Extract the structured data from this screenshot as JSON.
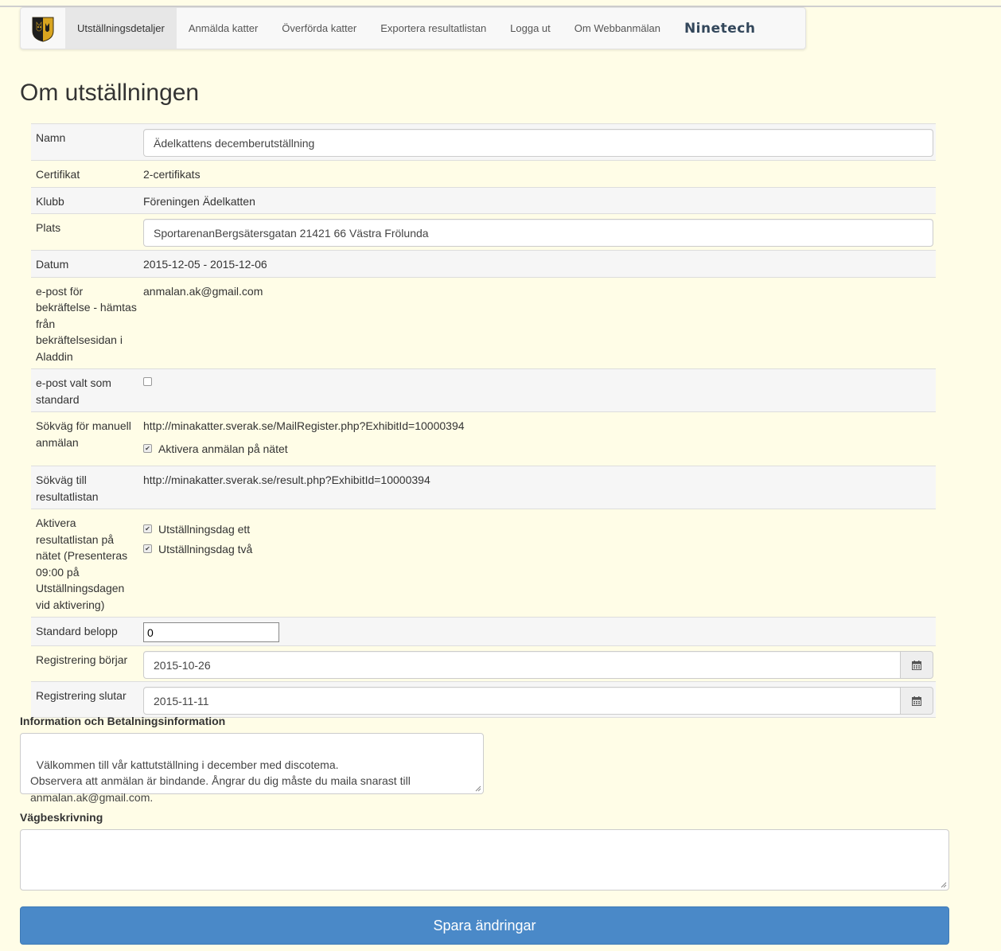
{
  "nav": {
    "items": [
      {
        "label": "Utställningsdetaljer"
      },
      {
        "label": "Anmälda katter"
      },
      {
        "label": "Överförda katter"
      },
      {
        "label": "Exportera resultatlistan"
      },
      {
        "label": "Logga ut"
      },
      {
        "label": "Om Webbanmälan"
      }
    ],
    "brand": "Ninetech",
    "active_index": 0
  },
  "page": {
    "title": "Om utställningen"
  },
  "details": {
    "namn_label": "Namn",
    "namn_value": "Ädelkattens decemberutställning",
    "certifikat_label": "Certifikat",
    "certifikat_value": "2-certifikats",
    "klubb_label": "Klubb",
    "klubb_value": "Föreningen Ädelkatten",
    "plats_label": "Plats",
    "plats_value": "SportarenanBergsätersgatan 21421 66 Västra Frölunda",
    "datum_label": "Datum",
    "datum_value": "2015-12-05 - 2015-12-06",
    "epost_label": "e-post för bekräftelse - hämtas från bekräftelsesidan i Aladdin",
    "epost_value": "anmalan.ak@gmail.com",
    "epost_standard_label": "e-post valt som standard",
    "epost_standard_checked": false,
    "sokvag_manuell_label": "Sökväg för manuell anmälan",
    "sokvag_manuell_value": "http://minakatter.sverak.se/MailRegister.php?ExhibitId=10000394",
    "aktivera_anmalan_label": "Aktivera anmälan på nätet",
    "aktivera_anmalan_checked": true,
    "sokvag_resultat_label": "Sökväg till resultatlistan",
    "sokvag_resultat_value": "http://minakatter.sverak.se/result.php?ExhibitId=10000394",
    "aktivera_resultat_label": "Aktivera resultatlistan på nätet (Presenteras 09:00 på Utställningsdagen vid aktivering)",
    "dag_ett_label": "Utställningsdag ett",
    "dag_ett_checked": true,
    "dag_tva_label": "Utställningsdag två",
    "dag_tva_checked": true,
    "belopp_label": "Standard belopp",
    "belopp_value": "0",
    "reg_borjar_label": "Registrering börjar",
    "reg_borjar_value": "2015-10-26",
    "reg_slutar_label": "Registrering slutar",
    "reg_slutar_value": "2015-11-11"
  },
  "info": {
    "label": "Information och Betalningsinformation",
    "value": "Välkommen till vår kattutställning i december med discotema.\nObservera att anmälan är bindande. Ångrar du dig måste du maila snarast till anmalan.ak@gmail.com."
  },
  "directions": {
    "label": "Vägbeskrivning",
    "value": ""
  },
  "save_button": "Spara ändringar",
  "icons": {
    "calendar": "calendar-icon",
    "check": "✔"
  },
  "colors": {
    "background": "#fffde7",
    "primary_button": "#4a89c8",
    "brand_text": "#33475b"
  }
}
